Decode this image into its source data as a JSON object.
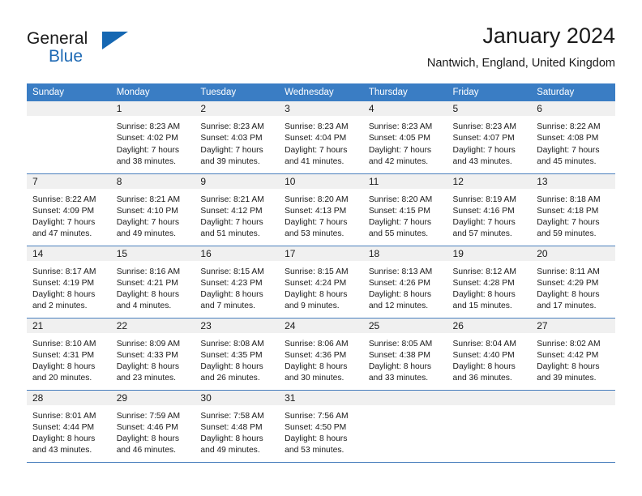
{
  "logo": {
    "word_general": "General",
    "word_blue": "Blue",
    "triangle_color": "#1567b2",
    "blue_text_color": "#1f6ab4"
  },
  "header": {
    "title": "January 2024",
    "subtitle": "Nantwich, England, United Kingdom"
  },
  "theme": {
    "header_blue": "#3a7dc4",
    "row_separator_blue": "#4a7fbd",
    "date_band_gray": "#f0f0f0"
  },
  "weekday_headers": [
    "Sunday",
    "Monday",
    "Tuesday",
    "Wednesday",
    "Thursday",
    "Friday",
    "Saturday"
  ],
  "weeks": [
    [
      {
        "day": "",
        "lines": []
      },
      {
        "day": "1",
        "lines": [
          "Sunrise: 8:23 AM",
          "Sunset: 4:02 PM",
          "Daylight: 7 hours",
          "and 38 minutes."
        ]
      },
      {
        "day": "2",
        "lines": [
          "Sunrise: 8:23 AM",
          "Sunset: 4:03 PM",
          "Daylight: 7 hours",
          "and 39 minutes."
        ]
      },
      {
        "day": "3",
        "lines": [
          "Sunrise: 8:23 AM",
          "Sunset: 4:04 PM",
          "Daylight: 7 hours",
          "and 41 minutes."
        ]
      },
      {
        "day": "4",
        "lines": [
          "Sunrise: 8:23 AM",
          "Sunset: 4:05 PM",
          "Daylight: 7 hours",
          "and 42 minutes."
        ]
      },
      {
        "day": "5",
        "lines": [
          "Sunrise: 8:23 AM",
          "Sunset: 4:07 PM",
          "Daylight: 7 hours",
          "and 43 minutes."
        ]
      },
      {
        "day": "6",
        "lines": [
          "Sunrise: 8:22 AM",
          "Sunset: 4:08 PM",
          "Daylight: 7 hours",
          "and 45 minutes."
        ]
      }
    ],
    [
      {
        "day": "7",
        "lines": [
          "Sunrise: 8:22 AM",
          "Sunset: 4:09 PM",
          "Daylight: 7 hours",
          "and 47 minutes."
        ]
      },
      {
        "day": "8",
        "lines": [
          "Sunrise: 8:21 AM",
          "Sunset: 4:10 PM",
          "Daylight: 7 hours",
          "and 49 minutes."
        ]
      },
      {
        "day": "9",
        "lines": [
          "Sunrise: 8:21 AM",
          "Sunset: 4:12 PM",
          "Daylight: 7 hours",
          "and 51 minutes."
        ]
      },
      {
        "day": "10",
        "lines": [
          "Sunrise: 8:20 AM",
          "Sunset: 4:13 PM",
          "Daylight: 7 hours",
          "and 53 minutes."
        ]
      },
      {
        "day": "11",
        "lines": [
          "Sunrise: 8:20 AM",
          "Sunset: 4:15 PM",
          "Daylight: 7 hours",
          "and 55 minutes."
        ]
      },
      {
        "day": "12",
        "lines": [
          "Sunrise: 8:19 AM",
          "Sunset: 4:16 PM",
          "Daylight: 7 hours",
          "and 57 minutes."
        ]
      },
      {
        "day": "13",
        "lines": [
          "Sunrise: 8:18 AM",
          "Sunset: 4:18 PM",
          "Daylight: 7 hours",
          "and 59 minutes."
        ]
      }
    ],
    [
      {
        "day": "14",
        "lines": [
          "Sunrise: 8:17 AM",
          "Sunset: 4:19 PM",
          "Daylight: 8 hours",
          "and 2 minutes."
        ]
      },
      {
        "day": "15",
        "lines": [
          "Sunrise: 8:16 AM",
          "Sunset: 4:21 PM",
          "Daylight: 8 hours",
          "and 4 minutes."
        ]
      },
      {
        "day": "16",
        "lines": [
          "Sunrise: 8:15 AM",
          "Sunset: 4:23 PM",
          "Daylight: 8 hours",
          "and 7 minutes."
        ]
      },
      {
        "day": "17",
        "lines": [
          "Sunrise: 8:15 AM",
          "Sunset: 4:24 PM",
          "Daylight: 8 hours",
          "and 9 minutes."
        ]
      },
      {
        "day": "18",
        "lines": [
          "Sunrise: 8:13 AM",
          "Sunset: 4:26 PM",
          "Daylight: 8 hours",
          "and 12 minutes."
        ]
      },
      {
        "day": "19",
        "lines": [
          "Sunrise: 8:12 AM",
          "Sunset: 4:28 PM",
          "Daylight: 8 hours",
          "and 15 minutes."
        ]
      },
      {
        "day": "20",
        "lines": [
          "Sunrise: 8:11 AM",
          "Sunset: 4:29 PM",
          "Daylight: 8 hours",
          "and 17 minutes."
        ]
      }
    ],
    [
      {
        "day": "21",
        "lines": [
          "Sunrise: 8:10 AM",
          "Sunset: 4:31 PM",
          "Daylight: 8 hours",
          "and 20 minutes."
        ]
      },
      {
        "day": "22",
        "lines": [
          "Sunrise: 8:09 AM",
          "Sunset: 4:33 PM",
          "Daylight: 8 hours",
          "and 23 minutes."
        ]
      },
      {
        "day": "23",
        "lines": [
          "Sunrise: 8:08 AM",
          "Sunset: 4:35 PM",
          "Daylight: 8 hours",
          "and 26 minutes."
        ]
      },
      {
        "day": "24",
        "lines": [
          "Sunrise: 8:06 AM",
          "Sunset: 4:36 PM",
          "Daylight: 8 hours",
          "and 30 minutes."
        ]
      },
      {
        "day": "25",
        "lines": [
          "Sunrise: 8:05 AM",
          "Sunset: 4:38 PM",
          "Daylight: 8 hours",
          "and 33 minutes."
        ]
      },
      {
        "day": "26",
        "lines": [
          "Sunrise: 8:04 AM",
          "Sunset: 4:40 PM",
          "Daylight: 8 hours",
          "and 36 minutes."
        ]
      },
      {
        "day": "27",
        "lines": [
          "Sunrise: 8:02 AM",
          "Sunset: 4:42 PM",
          "Daylight: 8 hours",
          "and 39 minutes."
        ]
      }
    ],
    [
      {
        "day": "28",
        "lines": [
          "Sunrise: 8:01 AM",
          "Sunset: 4:44 PM",
          "Daylight: 8 hours",
          "and 43 minutes."
        ]
      },
      {
        "day": "29",
        "lines": [
          "Sunrise: 7:59 AM",
          "Sunset: 4:46 PM",
          "Daylight: 8 hours",
          "and 46 minutes."
        ]
      },
      {
        "day": "30",
        "lines": [
          "Sunrise: 7:58 AM",
          "Sunset: 4:48 PM",
          "Daylight: 8 hours",
          "and 49 minutes."
        ]
      },
      {
        "day": "31",
        "lines": [
          "Sunrise: 7:56 AM",
          "Sunset: 4:50 PM",
          "Daylight: 8 hours",
          "and 53 minutes."
        ]
      },
      {
        "day": "",
        "lines": []
      },
      {
        "day": "",
        "lines": []
      },
      {
        "day": "",
        "lines": []
      }
    ]
  ]
}
